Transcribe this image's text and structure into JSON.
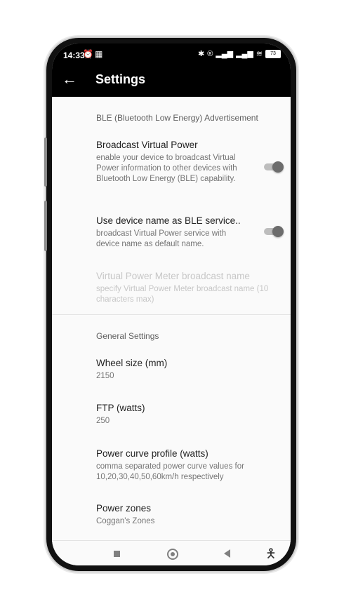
{
  "status_bar": {
    "time": "14:33",
    "left_icons": [
      "alarm-icon",
      "qr-icon"
    ],
    "right_icons": [
      "bluetooth-icon",
      "registered-icon",
      "signal-icon",
      "signal-icon",
      "wifi-icon"
    ],
    "battery": "73"
  },
  "app_bar": {
    "back_icon": "arrow-left-icon",
    "title": "Settings"
  },
  "ble_section": {
    "title": "BLE (Bluetooth Low Energy) Advertisement",
    "broadcast": {
      "title": "Broadcast Virtual Power",
      "summary": "enable your device to broadcast Virtual Power information to other devices with Bluetooth Low Energy (BLE) capability.",
      "enabled": true
    },
    "use_device_name": {
      "title": "Use device name as BLE service..",
      "summary": "broadcast Virtual Power service with device name as default name.",
      "enabled": true
    },
    "broadcast_name": {
      "title": "Virtual Power Meter broadcast name",
      "summary": "specify Virtual Power Meter broadcast name (10 characters max)"
    }
  },
  "general_section": {
    "title": "General Settings",
    "wheel_size": {
      "title": "Wheel size (mm)",
      "value": "2150"
    },
    "ftp": {
      "title": "FTP (watts)",
      "value": "250"
    },
    "power_curve": {
      "title": "Power curve profile (watts)",
      "summary": "comma separated power curve values for 10,20,30,40,50,60km/h respectively"
    },
    "power_zones": {
      "title": "Power zones",
      "value": "Coggan's Zones"
    }
  },
  "nav_bar": {
    "icons": [
      "recents-square-icon",
      "home-circle-icon",
      "back-triangle-icon",
      "accessibility-icon"
    ]
  },
  "colors": {
    "app_bar": "#000000",
    "background": "#fafafa",
    "toggle_thumb": "#6c6c6c"
  }
}
